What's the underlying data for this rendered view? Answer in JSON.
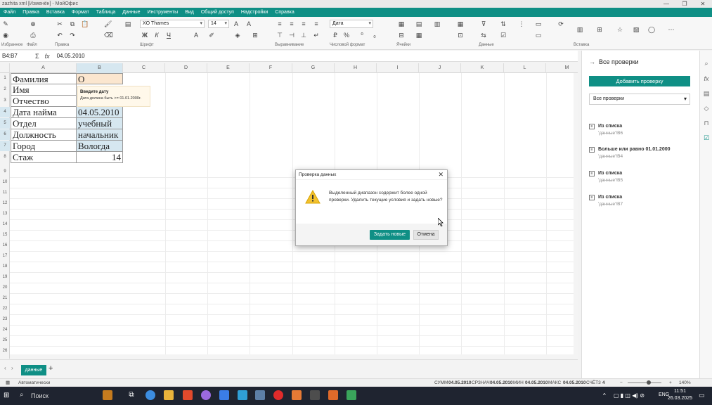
{
  "window": {
    "title": "zazhita xml [Изменён] - МойОфис",
    "controls": [
      "—",
      "❐",
      "✕"
    ]
  },
  "menu": [
    "Файл",
    "Правка",
    "Вставка",
    "Формат",
    "Таблица",
    "Данные",
    "Инструменты",
    "Вид",
    "Общий доступ",
    "Надстройки",
    "Справка"
  ],
  "ribbon": {
    "font_name": "XO Thames",
    "font_size": "14",
    "number_format": "Дата",
    "groups": [
      "Избранное",
      "Файл",
      "Правка",
      "Шрифт",
      "Выравнивание",
      "Числовой формат",
      "Ячейки",
      "Данные",
      "Вставка"
    ]
  },
  "formula_bar": {
    "cell_ref": "B4:B7",
    "fx": "fx",
    "value": "04.05.2010"
  },
  "columns": [
    "A",
    "B",
    "C",
    "D",
    "E",
    "F",
    "G",
    "H",
    "I",
    "J",
    "K",
    "L",
    "M"
  ],
  "rows": [
    "1",
    "2",
    "3",
    "4",
    "5",
    "6",
    "7",
    "8",
    "9",
    "10",
    "11",
    "12",
    "13",
    "14",
    "15",
    "16",
    "17",
    "18",
    "19",
    "20",
    "21",
    "22",
    "23",
    "24",
    "25",
    "26",
    "27"
  ],
  "cells": [
    {
      "a": "Фамилия",
      "b": "О"
    },
    {
      "a": "Имя",
      "b": ""
    },
    {
      "a": "Отчество",
      "b": ""
    },
    {
      "a": "Дата найма",
      "b": "04.05.2010"
    },
    {
      "a": "Отдел",
      "b": "учебный"
    },
    {
      "a": "Должность",
      "b": "начальник"
    },
    {
      "a": "Город",
      "b": "Вологда"
    },
    {
      "a": "Стаж",
      "b": "14"
    }
  ],
  "tooltip": {
    "title": "Введите дату",
    "body": "Дата должна быть >= 01.01.2000г."
  },
  "dialog": {
    "title": "Проверка данных",
    "message": "Выделенный диапазон содержит более одной проверки. Удалить текущие условия и задать новые?",
    "ok_label": "Задать новые",
    "cancel_label": "Отмена"
  },
  "panel": {
    "title": "Все проверки",
    "add_button": "Добавить проверку",
    "filter": "Все проверки",
    "items": [
      {
        "name": "Из списка",
        "range": "'данные'!B6"
      },
      {
        "name": "Больше или равно 01.01.2000",
        "range": "'данные'!B4"
      },
      {
        "name": "Из списка",
        "range": "'данные'!B5"
      },
      {
        "name": "Из списка",
        "range": "'данные'!B7"
      }
    ]
  },
  "sheet_tabs": [
    "данные"
  ],
  "status": {
    "mode": "Автоматически",
    "sum_label": "СУММ",
    "sum": "04.05.2010",
    "avg_label": "СРЗНАЧ",
    "avg": "04.05.2010",
    "min_label": "МИН",
    "min": "04.05.2010",
    "max_label": "МАКС",
    "max": "04.05.2010",
    "count_label": "СЧЁТ3",
    "count": "4",
    "zoom": "140%"
  },
  "taskbar": {
    "search": "Поиск",
    "lang": "ENG",
    "time": "11:51",
    "date": "26.03.2025"
  },
  "colors": {
    "accent": "#0f8f85",
    "selection": "#d6e7f0",
    "tooltip_bg": "#fff8ea",
    "taskbar": "#1f2430"
  }
}
